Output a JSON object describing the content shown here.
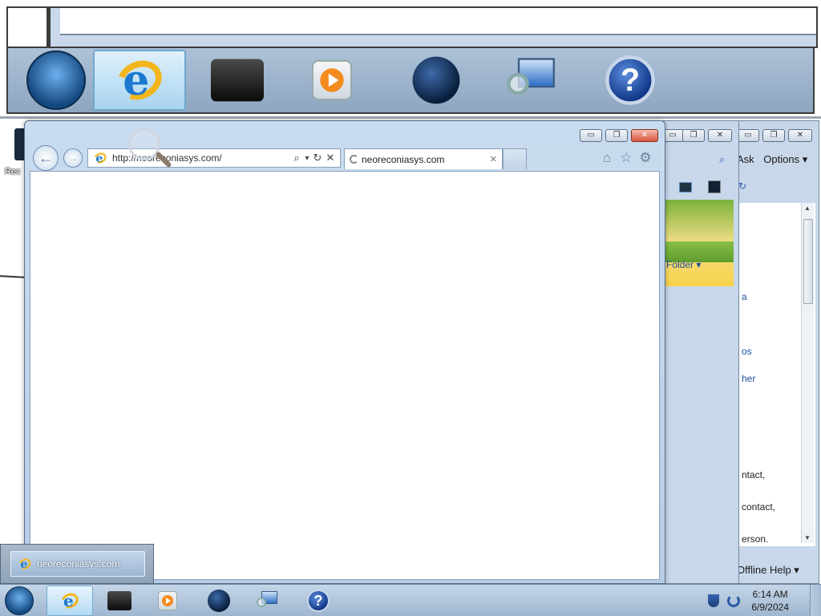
{
  "ie": {
    "address_url": "http://neoreconiasys.com/",
    "tab_title": "neoreconiasys.com",
    "back_glyph": "←",
    "forward_glyph": "→",
    "search_glyph": "⌕",
    "dropdown_glyph": "▾",
    "refresh_glyph": "↻",
    "stop_glyph": "✕",
    "tab_close_glyph": "✕",
    "home_glyph": "⌂",
    "favorites_glyph": "☆",
    "tools_glyph": "⚙",
    "min_glyph": "▭",
    "max_glyph": "❐",
    "close_glyph": "✕"
  },
  "back_window_1": {
    "search_glyph": "⌕",
    "folder_label": "Folder ▾",
    "min_glyph": "▭",
    "max_glyph": "❐",
    "close_glyph": "✕"
  },
  "back_window_2": {
    "ask_label": "Ask",
    "options_label": "Options ▾",
    "refresh_glyph": "↻",
    "fragments": [
      "a",
      "os",
      "her",
      "ntact,",
      "contact,",
      "erson."
    ],
    "help_label": "Offline Help ▾",
    "min_glyph": "▭",
    "max_glyph": "❐",
    "close_glyph": "✕"
  },
  "desktop": {
    "icon_label": "Rec"
  },
  "taskbar": {
    "items": [
      "internet-explorer",
      "printer",
      "media-player",
      "globe",
      "magnifier",
      "help"
    ],
    "active_item": "internet-explorer",
    "preview_title": "neoreconiasys.com",
    "help_glyph": "?",
    "clock_time": "6:14 AM",
    "clock_date": "6/9/2024"
  }
}
